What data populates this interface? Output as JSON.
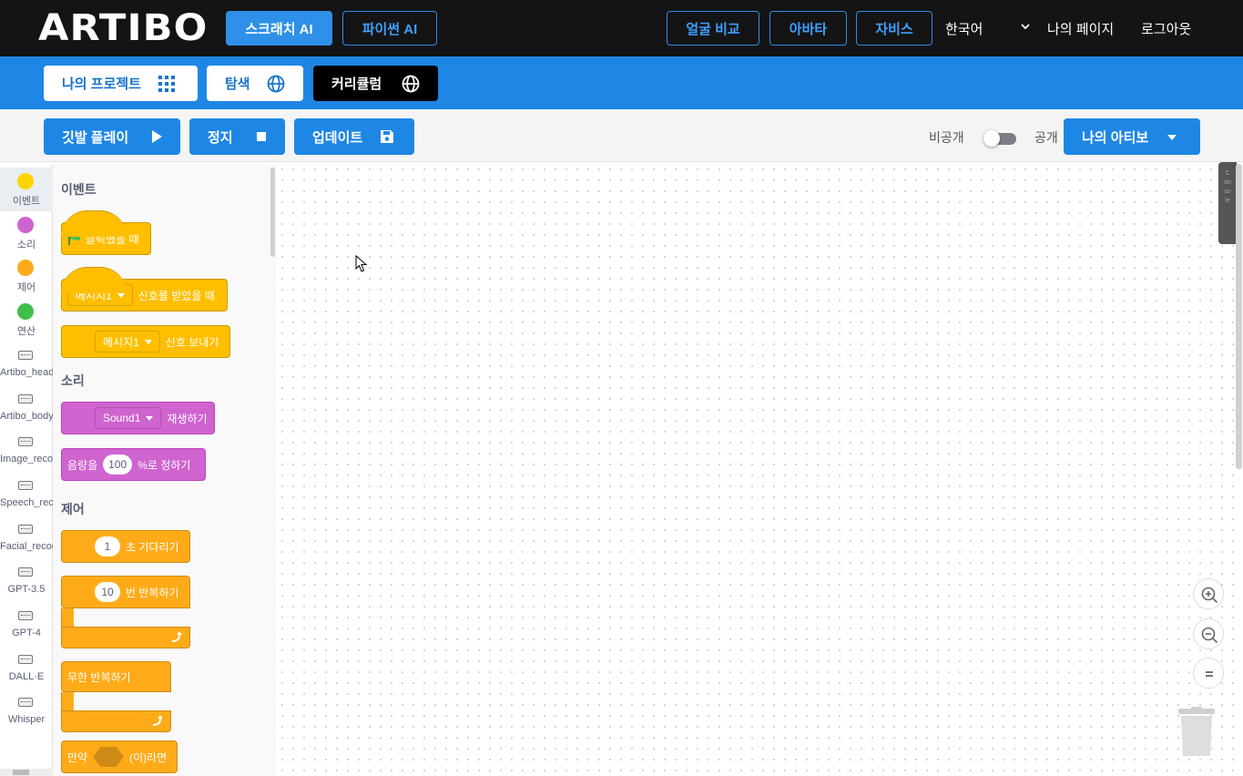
{
  "header": {
    "logo": "ARTIBO",
    "tabs": [
      {
        "label": "스크래치 AI",
        "active": true
      },
      {
        "label": "파이썬 AI",
        "active": false
      }
    ],
    "features": [
      "얼굴 비교",
      "아바타",
      "자비스"
    ],
    "language": "한국어",
    "my_page": "나의 페이지",
    "logout": "로그아웃"
  },
  "nav": {
    "my_projects": "나의 프로젝트",
    "explore": "탐색",
    "curriculum": "커리큘럼"
  },
  "toolbar": {
    "play": "깃발 플레이",
    "stop": "정지",
    "update": "업데이트",
    "private": "비공개",
    "public": "공개",
    "my_artibo": "나의 아티보"
  },
  "categories": [
    {
      "label": "이벤트",
      "color": "#ffd500",
      "type": "dot"
    },
    {
      "label": "소리",
      "color": "#cf63cf",
      "type": "dot"
    },
    {
      "label": "제어",
      "color": "#ffab19",
      "type": "dot"
    },
    {
      "label": "연산",
      "color": "#40bf4a",
      "type": "dot"
    },
    {
      "label": "Artibo_head",
      "type": "ext"
    },
    {
      "label": "Artibo_body",
      "type": "ext"
    },
    {
      "label": "Image_recog",
      "type": "ext"
    },
    {
      "label": "Speech_reco",
      "type": "ext"
    },
    {
      "label": "Facial_recog",
      "type": "ext"
    },
    {
      "label": "GPT-3.5",
      "type": "ext"
    },
    {
      "label": "GPT-4",
      "type": "ext"
    },
    {
      "label": "DALL·E",
      "type": "ext"
    },
    {
      "label": "Whisper",
      "type": "ext"
    }
  ],
  "palette": {
    "events_title": "이벤트",
    "when_clicked": "클릭했을 때",
    "message_dd": "메시지1",
    "when_receive": "신호를 받았을 때",
    "broadcast": "신호 보내기",
    "sound_title": "소리",
    "sound_dd": "Sound1",
    "play_sound": "재생하기",
    "volume_prefix": "음량을",
    "volume_value": "100",
    "volume_suffix": "%로 정하기",
    "control_title": "제어",
    "wait_value": "1",
    "wait_label": "초 기다리기",
    "repeat_value": "10",
    "repeat_label": "번 반복하기",
    "forever_label": "무한 반복하기",
    "if_prefix": "만약",
    "if_suffix": "(이)라면"
  },
  "workspace": {
    "console_label": "Console"
  }
}
